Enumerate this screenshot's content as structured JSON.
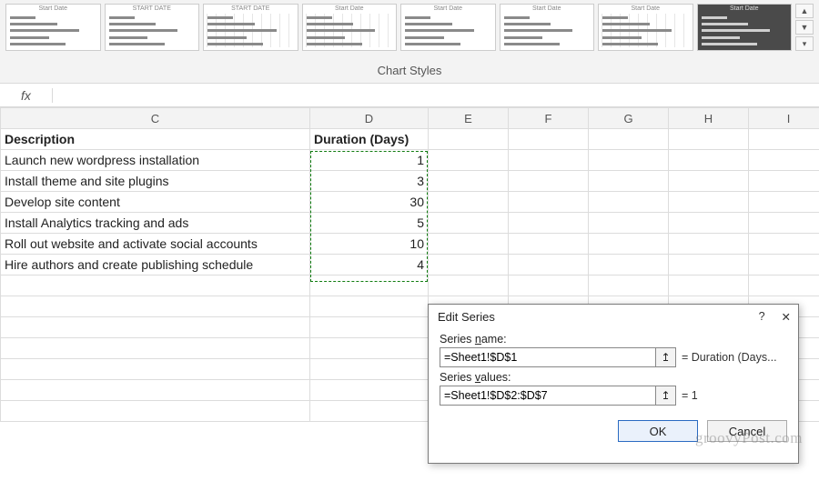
{
  "ribbon": {
    "group_label": "Chart Styles",
    "thumbs": [
      {
        "title": "Start Date",
        "dark": false
      },
      {
        "title": "START DATE",
        "dark": false
      },
      {
        "title": "START DATE",
        "dark": false
      },
      {
        "title": "Start Date",
        "dark": false
      },
      {
        "title": "Start Date",
        "dark": false
      },
      {
        "title": "Start Date",
        "dark": false
      },
      {
        "title": "Start Date",
        "dark": false
      },
      {
        "title": "Start Date",
        "dark": true
      }
    ]
  },
  "formula_bar": {
    "label": "fx",
    "value": ""
  },
  "columns": [
    "C",
    "D",
    "E",
    "F",
    "G",
    "H",
    "I"
  ],
  "headers": {
    "C": "Description",
    "D": "Duration (Days)"
  },
  "rows": [
    {
      "desc": "Launch new wordpress installation",
      "dur": "1"
    },
    {
      "desc": "Install theme and site plugins",
      "dur": "3"
    },
    {
      "desc": "Develop site content",
      "dur": "30"
    },
    {
      "desc": "Install Analytics tracking and ads",
      "dur": "5"
    },
    {
      "desc": "Roll out website and activate social accounts",
      "dur": "10"
    },
    {
      "desc": "Hire authors and create publishing schedule",
      "dur": "4"
    }
  ],
  "dialog": {
    "title": "Edit Series",
    "help": "?",
    "close": "✕",
    "series_name_label": "Series name:",
    "series_name_value": "=Sheet1!$D$1",
    "series_name_result": "= Duration (Days...",
    "series_values_label": "Series values:",
    "series_values_value": "=Sheet1!$D$2:$D$7",
    "series_values_result": "= 1",
    "ok": "OK",
    "cancel": "Cancel"
  },
  "watermark": "groovyPost.com",
  "chart_data": {
    "type": "bar",
    "title": "Duration (Days)",
    "categories": [
      "Launch new wordpress installation",
      "Install theme and site plugins",
      "Develop site content",
      "Install Analytics tracking and ads",
      "Roll out website and activate social accounts",
      "Hire authors and create publishing schedule"
    ],
    "values": [
      1,
      3,
      30,
      5,
      10,
      4
    ],
    "xlabel": "",
    "ylabel": "Duration (Days)",
    "ylim": [
      0,
      30
    ]
  }
}
